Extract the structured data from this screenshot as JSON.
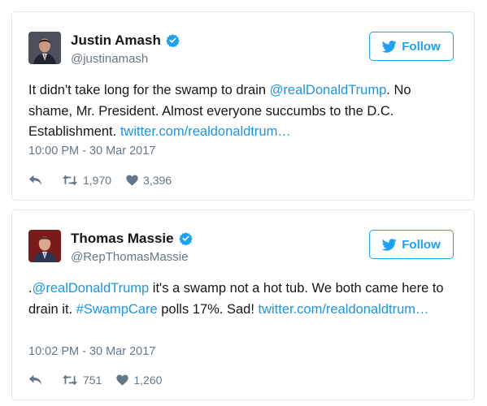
{
  "colors": {
    "accent": "#1da1f2",
    "link": "#1b95e0",
    "muted": "#657786",
    "text": "#14171a",
    "border": "#e1e8ed"
  },
  "tweets": [
    {
      "name": "Justin Amash",
      "handle": "@justinamash",
      "follow_label": "Follow",
      "text_parts": [
        {
          "t": "It didn't take long for the swamp to drain ",
          "link": false
        },
        {
          "t": "@realDonaldTrump",
          "link": true
        },
        {
          "t": ". No shame, Mr. President. Almost everyone succumbs to the D.C. Establishment. ",
          "link": false
        },
        {
          "t": "twitter.com/realdonaldtrum…",
          "link": true
        }
      ],
      "timestamp": "10:00 PM - 30 Mar 2017",
      "retweets": "1,970",
      "likes": "3,396"
    },
    {
      "name": "Thomas Massie",
      "handle": "@RepThomasMassie",
      "follow_label": "Follow",
      "text_parts": [
        {
          "t": ".",
          "link": false
        },
        {
          "t": "@realDonaldTrump",
          "link": true
        },
        {
          "t": " it's a swamp not a hot tub. We both came here to drain it. ",
          "link": false
        },
        {
          "t": "#SwampCare",
          "link": true
        },
        {
          "t": " polls 17%. Sad! ",
          "link": false
        },
        {
          "t": "twitter.com/realdonaldtrum…",
          "link": true
        }
      ],
      "timestamp": "10:02 PM - 30 Mar 2017",
      "retweets": "751",
      "likes": "1,260"
    }
  ]
}
